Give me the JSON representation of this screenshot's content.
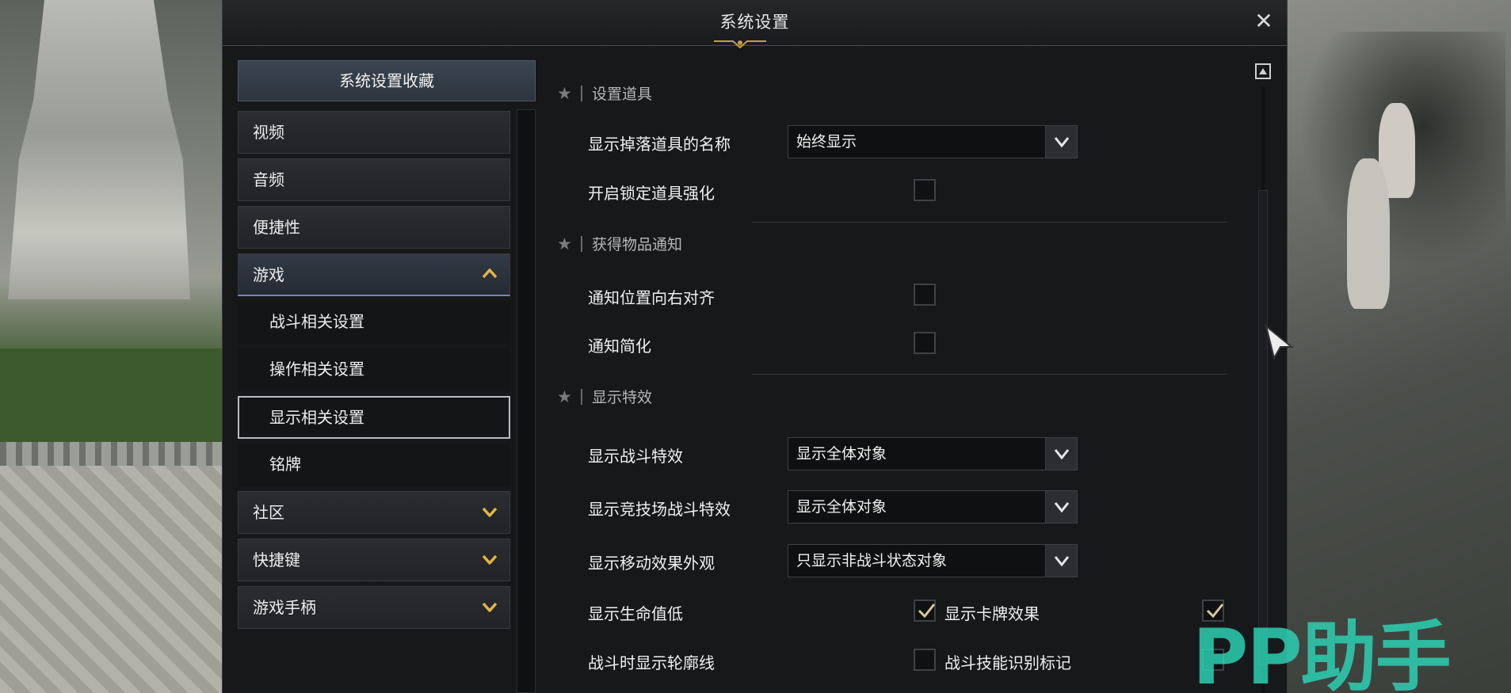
{
  "window": {
    "title": "系统设置"
  },
  "nav": {
    "favorites_label": "系统设置收藏",
    "items": [
      {
        "label": "视频"
      },
      {
        "label": "音频"
      },
      {
        "label": "便捷性"
      },
      {
        "label": "游戏",
        "expanded": true,
        "children": [
          "战斗相关设置",
          "操作相关设置",
          "显示相关设置",
          "铭牌"
        ],
        "selected_child": "显示相关设置"
      },
      {
        "label": "社区"
      },
      {
        "label": "快捷键"
      },
      {
        "label": "游戏手柄"
      }
    ]
  },
  "sections": [
    {
      "title": "设置道具",
      "rows": [
        {
          "label": "显示掉落道具的名称",
          "control": "dropdown",
          "value": "始终显示"
        },
        {
          "label": "开启锁定道具强化",
          "control": "checkbox",
          "checked": false
        }
      ]
    },
    {
      "title": "获得物品通知",
      "rows": [
        {
          "label": "通知位置向右对齐",
          "control": "checkbox",
          "checked": false
        },
        {
          "label": "通知简化",
          "control": "checkbox",
          "checked": false
        }
      ]
    },
    {
      "title": "显示特效",
      "rows": [
        {
          "label": "显示战斗特效",
          "control": "dropdown",
          "value": "显示全体对象"
        },
        {
          "label": "显示竞技场战斗特效",
          "control": "dropdown",
          "value": "显示全体对象"
        },
        {
          "label": "显示移动效果外观",
          "control": "dropdown",
          "value": "只显示非战斗状态对象"
        },
        {
          "label": "显示生命值低",
          "control": "checkbox",
          "checked": true
        },
        {
          "label": "显示卡牌效果",
          "control": "checkbox",
          "checked": true
        },
        {
          "label": "战斗时显示轮廓线",
          "control": "checkbox",
          "checked": false
        },
        {
          "label": "战斗技能识别标记",
          "control": "checkbox",
          "checked": false
        }
      ]
    }
  ],
  "watermark": "PP助手",
  "colors": {
    "accent_gold": "#e2b54a",
    "panel_bg": "#17181a",
    "watermark": "#2cd6b8"
  }
}
